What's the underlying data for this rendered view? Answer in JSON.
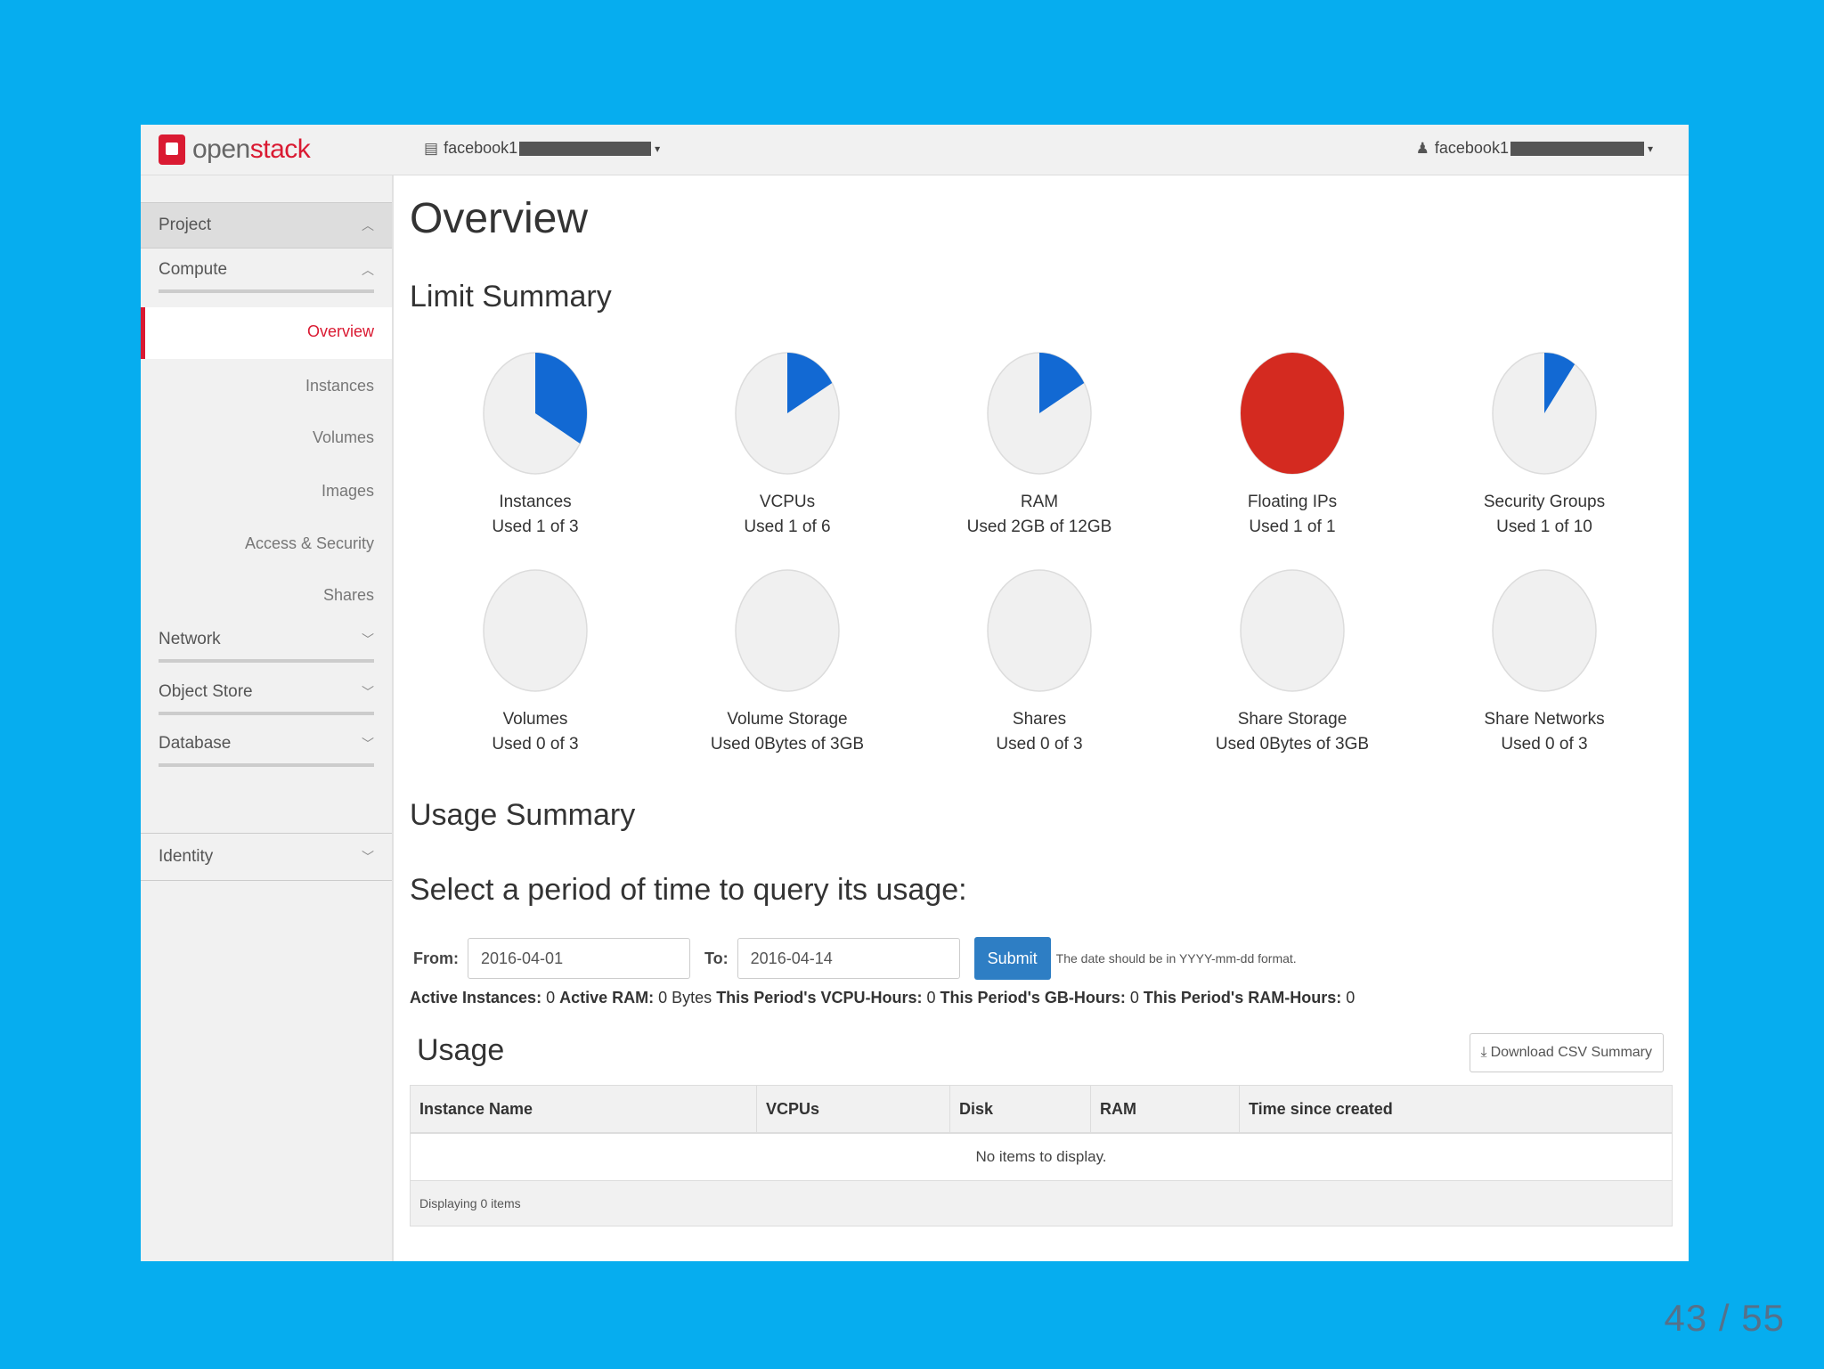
{
  "app": {
    "logo_prefix": "open",
    "logo_suffix": "stack",
    "project_selector": "facebook1",
    "user_menu": "facebook1"
  },
  "sidebar": {
    "project_label": "Project",
    "compute_label": "Compute",
    "compute_items": [
      "Overview",
      "Instances",
      "Volumes",
      "Images",
      "Access & Security",
      "Shares"
    ],
    "active_item": "Overview",
    "network_label": "Network",
    "object_store_label": "Object Store",
    "database_label": "Database",
    "identity_label": "Identity"
  },
  "main": {
    "title": "Overview",
    "limit_summary_title": "Limit Summary",
    "usage_summary_title": "Usage Summary",
    "period_title": "Select a period of time to query its usage:",
    "form": {
      "from_label": "From:",
      "from_value": "2016-04-01",
      "to_label": "To:",
      "to_value": "2016-04-14",
      "submit_label": "Submit",
      "hint": "The date should be in YYYY-mm-dd format."
    },
    "stats": [
      {
        "label": "Active Instances:",
        "value": "0"
      },
      {
        "label": "Active RAM:",
        "value": "0 Bytes"
      },
      {
        "label": "This Period's VCPU-Hours:",
        "value": "0"
      },
      {
        "label": "This Period's GB-Hours:",
        "value": "0"
      },
      {
        "label": "This Period's RAM-Hours:",
        "value": "0"
      }
    ],
    "usage_title": "Usage",
    "csv_button": "Download CSV Summary",
    "table": {
      "columns": [
        "Instance Name",
        "VCPUs",
        "Disk",
        "RAM",
        "Time since created"
      ],
      "empty_text": "No items to display.",
      "footer": "Displaying 0 items"
    }
  },
  "limits": [
    {
      "name": "Instances",
      "usage": "Used 1 of 3",
      "fraction": 0.3333,
      "color": "#1269d3"
    },
    {
      "name": "VCPUs",
      "usage": "Used 1 of 6",
      "fraction": 0.1667,
      "color": "#1269d3"
    },
    {
      "name": "RAM",
      "usage": "Used 2GB of 12GB",
      "fraction": 0.1667,
      "color": "#1269d3"
    },
    {
      "name": "Floating IPs",
      "usage": "Used 1 of 1",
      "fraction": 1.0,
      "color": "#d42a20"
    },
    {
      "name": "Security Groups",
      "usage": "Used 1 of 10",
      "fraction": 0.1,
      "color": "#1269d3"
    },
    {
      "name": "Volumes",
      "usage": "Used 0 of 3",
      "fraction": 0,
      "color": "#1269d3"
    },
    {
      "name": "Volume Storage",
      "usage": "Used 0Bytes of 3GB",
      "fraction": 0,
      "color": "#1269d3"
    },
    {
      "name": "Shares",
      "usage": "Used 0 of 3",
      "fraction": 0,
      "color": "#1269d3"
    },
    {
      "name": "Share Storage",
      "usage": "Used 0Bytes of 3GB",
      "fraction": 0,
      "color": "#1269d3"
    },
    {
      "name": "Share Networks",
      "usage": "Used 0 of 3",
      "fraction": 0,
      "color": "#1269d3"
    }
  ],
  "slide_counter": "43 / 55",
  "colors": {
    "background": "#06adef",
    "accent_red": "#da1a32",
    "pie_blue": "#1269d3",
    "pie_full": "#d42a20",
    "pie_empty": "#f0f0f0",
    "submit_blue": "#2e7ec4"
  }
}
